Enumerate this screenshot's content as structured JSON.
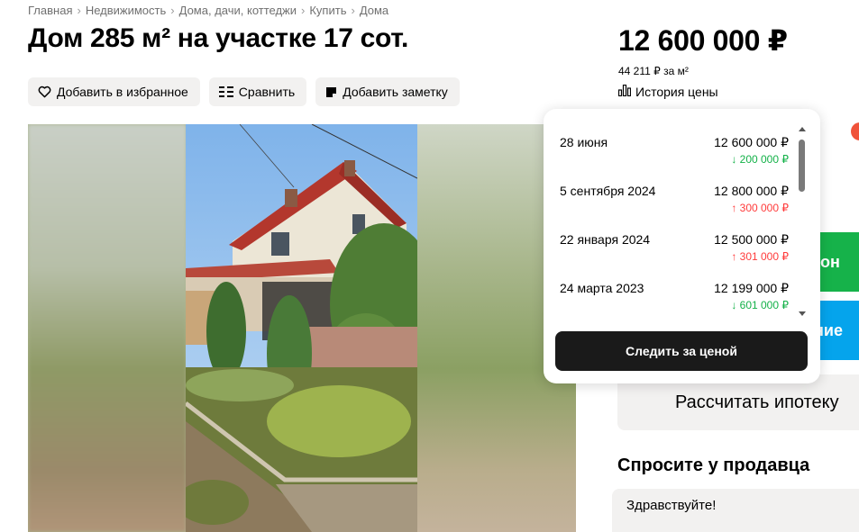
{
  "breadcrumb": [
    "Главная",
    "Недвижимость",
    "Дома, дачи, коттеджи",
    "Купить",
    "Дома"
  ],
  "title": "Дом 285 м² на участке 17 сот.",
  "actions": {
    "favorite": "Добавить в избранное",
    "compare": "Сравнить",
    "note": "Добавить заметку"
  },
  "price": {
    "value": "12 600 000 ₽",
    "per_m2": "44 211 ₽ за м²",
    "history_link": "История цены"
  },
  "price_history": {
    "items": [
      {
        "date": "28 июня",
        "price": "12 600 000 ₽",
        "change": "↓ 200 000 ₽",
        "direction": "down"
      },
      {
        "date": "5 сентября 2024",
        "price": "12 800 000 ₽",
        "change": "↑ 300 000 ₽",
        "direction": "up"
      },
      {
        "date": "22 января 2024",
        "price": "12 500 000 ₽",
        "change": "↑ 301 000 ₽",
        "direction": "up"
      },
      {
        "date": "24 марта 2023",
        "price": "12 199 000 ₽",
        "change": "↓ 601 000 ₽",
        "direction": "down"
      }
    ],
    "follow_button": "Следить за ценой"
  },
  "contact": {
    "green_partial": "он",
    "blue_partial": "ние"
  },
  "mortgage_button": "Рассчитать ипотеку",
  "ask_seller": {
    "title": "Спросите у продавца",
    "message": "Здравствуйте!"
  },
  "colors": {
    "green": "#16b24a",
    "blue": "#05a4ec",
    "price_down": "#13b148",
    "price_up": "#ff3b3b",
    "button_bg": "#f2f1f0"
  }
}
